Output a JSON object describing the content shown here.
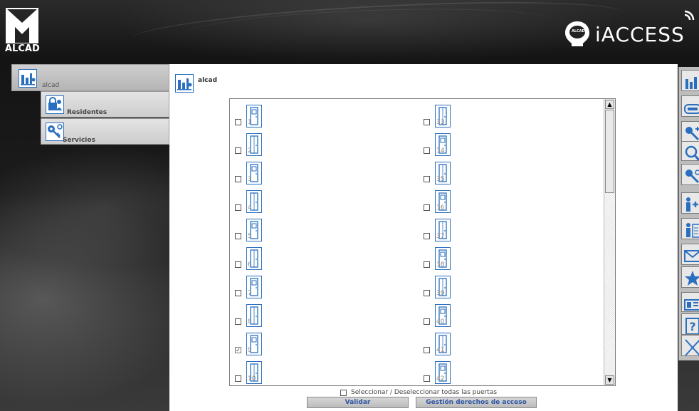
{
  "brand": {
    "left_logo_text": "ALCAD",
    "right_logo_text": "iACCESS",
    "bulb_text": "ALCAD"
  },
  "nav": {
    "home_label": "alcad",
    "residents_label": "Residentes",
    "services_label": "Servicios"
  },
  "breadcrumb": {
    "label": "alcad"
  },
  "doors": {
    "left": [
      {
        "num": "1",
        "checked": false
      },
      {
        "num": "2",
        "checked": false
      },
      {
        "num": "3",
        "checked": false
      },
      {
        "num": "4",
        "checked": false
      },
      {
        "num": "5",
        "checked": false
      },
      {
        "num": "6",
        "checked": false
      },
      {
        "num": "7",
        "checked": false
      },
      {
        "num": "8",
        "checked": false
      },
      {
        "num": "9",
        "checked": true
      },
      {
        "num": "10",
        "checked": false
      }
    ],
    "right": [
      {
        "num": "33",
        "checked": false
      },
      {
        "num": "34",
        "checked": false
      },
      {
        "num": "35",
        "checked": false
      },
      {
        "num": "36",
        "checked": false
      },
      {
        "num": "37",
        "checked": false
      },
      {
        "num": "38",
        "checked": false
      },
      {
        "num": "39",
        "checked": false
      },
      {
        "num": "40",
        "checked": false
      },
      {
        "num": "41",
        "checked": false
      },
      {
        "num": "42",
        "checked": false
      }
    ]
  },
  "select_all_label": "Seleccionar / Deseleccionar todas las puertas",
  "buttons": {
    "validate": "Validar",
    "access_rights": "Gestión derechos de acceso"
  },
  "colors": {
    "icon_blue": "#2a6fbf",
    "link_blue": "#2d56a4"
  },
  "right_toolbar": [
    "chart-icon",
    "id-card-icon",
    "key-add-icon",
    "search-icon",
    "key-search-icon",
    "user-add-icon",
    "user-list-icon",
    "mail-icon",
    "star-icon",
    "device-icon",
    "help-icon",
    "close-icon"
  ]
}
